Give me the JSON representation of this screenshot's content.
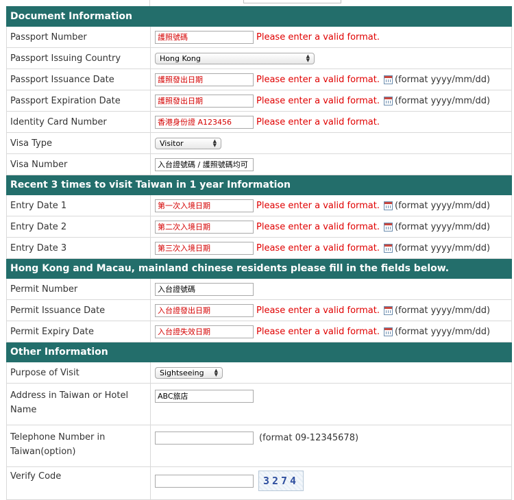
{
  "sections": {
    "document": "Document Information",
    "visits": "Recent 3 times to visit Taiwan in 1 year Information",
    "permit": "Hong Kong and Macau, mainland chinese residents please fill in the fields below.",
    "other": "Other Information"
  },
  "common": {
    "error": "Please enter a valid format.",
    "date_format": "(format yyyy/mm/dd)",
    "tel_format": "(format 09-12345678)"
  },
  "document": {
    "passport_number": {
      "label": "Passport Number",
      "placeholder": "護照號碼"
    },
    "issuing_country": {
      "label": "Passport Issuing Country",
      "value": "Hong Kong"
    },
    "issuance_date": {
      "label": "Passport Issuance Date",
      "placeholder": "護照發出日期"
    },
    "expiration_date": {
      "label": "Passport Expiration Date",
      "placeholder": "護照發出日期"
    },
    "id_card": {
      "label": "Identity Card Number",
      "placeholder": "香港身份證 A123456"
    },
    "visa_type": {
      "label": "Visa Type",
      "value": "Visitor"
    },
    "visa_number": {
      "label": "Visa Number",
      "value": "入台證號碼 / 護照號碼均可"
    }
  },
  "visits": {
    "entry1": {
      "label": "Entry Date 1",
      "placeholder": "第一次入境日期"
    },
    "entry2": {
      "label": "Entry Date 2",
      "placeholder": "第二次入境日期"
    },
    "entry3": {
      "label": "Entry Date 3",
      "placeholder": "第三次入境日期"
    }
  },
  "permit": {
    "number": {
      "label": "Permit Number",
      "value": "入台證號碼"
    },
    "issuance": {
      "label": "Permit Issuance Date",
      "placeholder": "入台證發出日期"
    },
    "expiry": {
      "label": "Permit Expiry Date",
      "placeholder": "入台證失效日期"
    }
  },
  "other": {
    "purpose": {
      "label": "Purpose of Visit",
      "value": "Sightseeing"
    },
    "address": {
      "label": "Address in Taiwan or Hotel Name",
      "value": "ABC旅店"
    },
    "telephone": {
      "label": "Telephone Number in Taiwan(option)",
      "value": ""
    },
    "verify": {
      "label": "Verify Code",
      "value": "",
      "captcha": "3274"
    }
  },
  "icons": {
    "calendar": "calendar-icon",
    "select_arrows": "updown-arrows-icon"
  }
}
